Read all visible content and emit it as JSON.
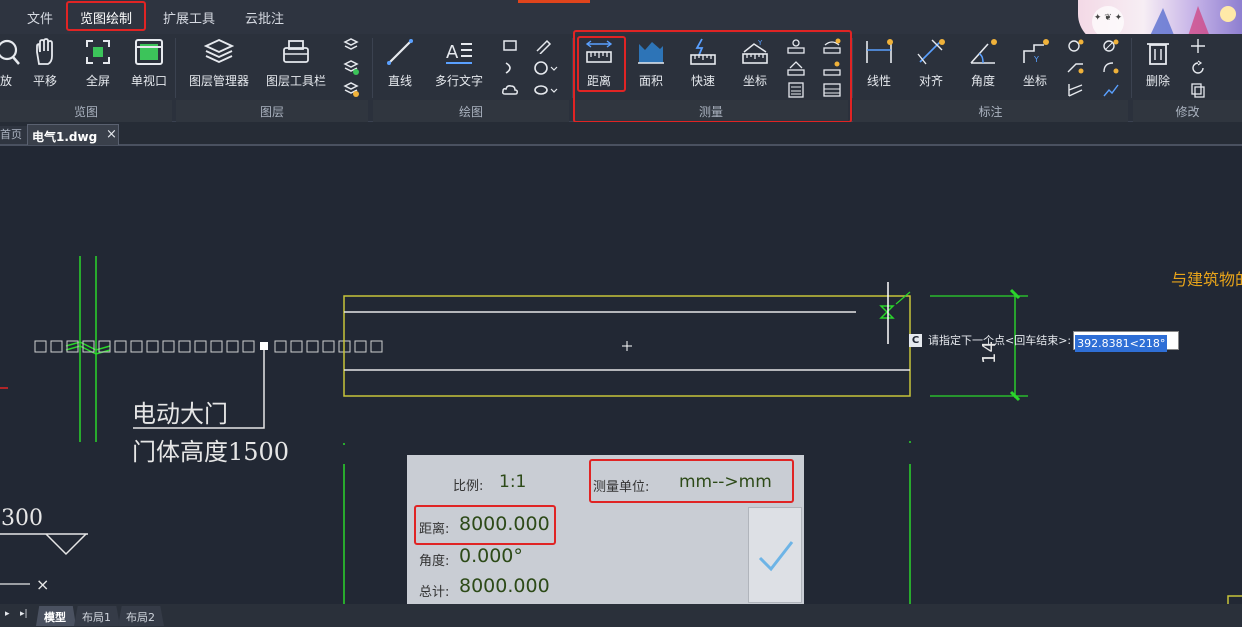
{
  "menu": {
    "items": [
      "文件",
      "览图绘制",
      "扩展工具",
      "云批注"
    ]
  },
  "ribbon": {
    "tools_view": [
      "放",
      "平移",
      "全屏",
      "单视口"
    ],
    "tools_layer": [
      "图层管理器",
      "图层工具栏"
    ],
    "tools_draw": [
      "直线",
      "多行文字"
    ],
    "tools_measure": [
      "距离",
      "面积",
      "快速",
      "坐标"
    ],
    "tools_annot": [
      "线性",
      "对齐",
      "角度",
      "坐标"
    ],
    "tools_modify": [
      "删除"
    ],
    "groups": [
      "览图",
      "图层",
      "绘图",
      "测量",
      "标注",
      "修改"
    ]
  },
  "tabs": {
    "home_partial": "首页",
    "file": "电气1.dwg",
    "close": "×"
  },
  "drawing": {
    "door_label": "电动大门",
    "door_height": "门体高度1500",
    "level_partial": ".300",
    "right_note": "与建筑物的",
    "dim_partial": "14"
  },
  "command": {
    "badge": "C",
    "prompt": "请指定下一个点<回车结束>:",
    "value": "392.8381<218°"
  },
  "measure_panel": {
    "scale_label": "比例:",
    "scale_value": "1:1",
    "unit_label": "测量单位:",
    "unit_value": "mm-->mm",
    "distance_label": "距离:",
    "distance_value": "8000.000",
    "angle_label": "角度:",
    "angle_value": "0.000°",
    "total_label": "总计:",
    "total_value": "8000.000"
  },
  "layout_tabs": [
    "模型",
    "布局1",
    "布局2"
  ],
  "colors": {
    "accent_red": "#e02424",
    "drawing_yellow": "#c8c43a",
    "drawing_green": "#2bd62b",
    "note_orange": "#e8a41a",
    "value_highlight": "#2f6fd6"
  }
}
